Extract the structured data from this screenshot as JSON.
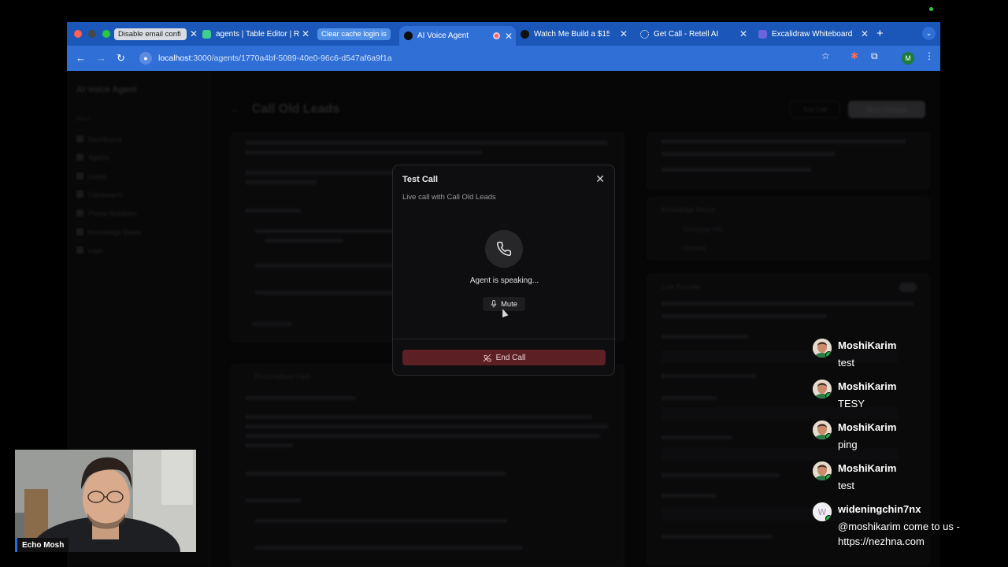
{
  "browser": {
    "tabs": [
      {
        "label": "Disable email confi",
        "kind": "group",
        "bg": "#d9dde3",
        "fg": "#1b1b1b"
      },
      {
        "label": "agents | Table Editor | R",
        "kind": "tab"
      },
      {
        "label": "Clear cache login is",
        "kind": "group",
        "bg": "#4f8fe8",
        "fg": "#ffffff"
      },
      {
        "label": "AI Voice Agent",
        "kind": "tab",
        "active": true
      },
      {
        "label": "Watch Me Build a $15K",
        "kind": "tab"
      },
      {
        "label": "Get Call - Retell AI",
        "kind": "tab"
      },
      {
        "label": "Excalidraw Whiteboard",
        "kind": "tab"
      }
    ],
    "url_host": "localhost",
    "url_path": ":3000/agents/1770a4bf-5089-40e0-96c6-d547af6a9f1a",
    "profile_initial": "M"
  },
  "page": {
    "app_name": "AI Voice Agent",
    "nav_section": "Menu",
    "nav_items": [
      "Dashboard",
      "Agents",
      "Leads",
      "Campaigns",
      "Phone Numbers",
      "Knowledge Bases",
      "Logs"
    ],
    "title": "Call Old Leads",
    "test_call_label": "Test Call",
    "save_label": "Save Changes",
    "knowledge_base_label": "Knowledge Bases",
    "kb_items": [
      "Company Info",
      "Untitled"
    ],
    "live_transfer_label": "Live Transfer",
    "section_label": "Personalized Pitch"
  },
  "dialog": {
    "title": "Test Call",
    "subtitle": "Live call with Call Old Leads",
    "status": "Agent is speaking...",
    "mute_label": "Mute",
    "end_label": "End Call",
    "close_symbol": "✕"
  },
  "webcam": {
    "name": "Echo Mosh"
  },
  "chat": {
    "messages": [
      {
        "user": "MoshiKarim",
        "text": "test",
        "avatar": "person"
      },
      {
        "user": "MoshiKarim",
        "text": "TESY",
        "avatar": "person"
      },
      {
        "user": "MoshiKarim",
        "text": "ping",
        "avatar": "person"
      },
      {
        "user": "MoshiKarim",
        "text": "test",
        "avatar": "person"
      },
      {
        "user": "wideningchin7nx",
        "text": "@moshikarim come to us - https://nezhna.com",
        "avatar": "letter-w"
      }
    ]
  },
  "colors": {
    "browser_accent": "#2f6fd6",
    "end_call": "#5b1f24",
    "online": "#1fb141"
  }
}
